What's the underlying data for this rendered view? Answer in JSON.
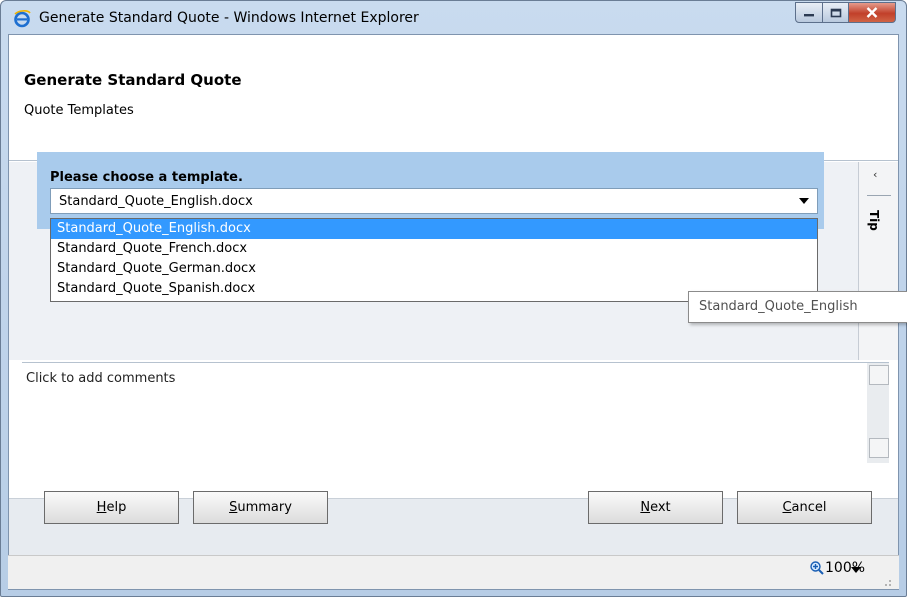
{
  "window": {
    "title": "Generate Standard Quote - Windows Internet Explorer"
  },
  "header": {
    "title": "Generate Standard Quote",
    "subtitle": "Quote Templates"
  },
  "template_picker": {
    "label": "Please choose a template.",
    "selected": "Standard_Quote_English.docx",
    "options": [
      "Standard_Quote_English.docx",
      "Standard_Quote_French.docx",
      "Standard_Quote_German.docx",
      "Standard_Quote_Spanish.docx"
    ],
    "highlighted_index": 0
  },
  "tooltip": "Standard_Quote_English",
  "tip_panel": {
    "label": "Tip",
    "collapse_glyph": "‹"
  },
  "comments": {
    "placeholder": "Click to add comments"
  },
  "buttons": {
    "help_mnemonic": "H",
    "help_rest": "elp",
    "summary_mnemonic": "S",
    "summary_rest": "ummary",
    "next_mnemonic": "N",
    "next_rest": "ext",
    "cancel_mnemonic": "C",
    "cancel_rest": "ancel"
  },
  "statusbar": {
    "zoom": "100%"
  },
  "icons": {
    "browser": "ie-icon",
    "zoom": "magnifier-plus-icon"
  },
  "colors": {
    "selected_option": "#3399ff",
    "panel": "#a9cbec",
    "close_button": "#c1402a"
  }
}
